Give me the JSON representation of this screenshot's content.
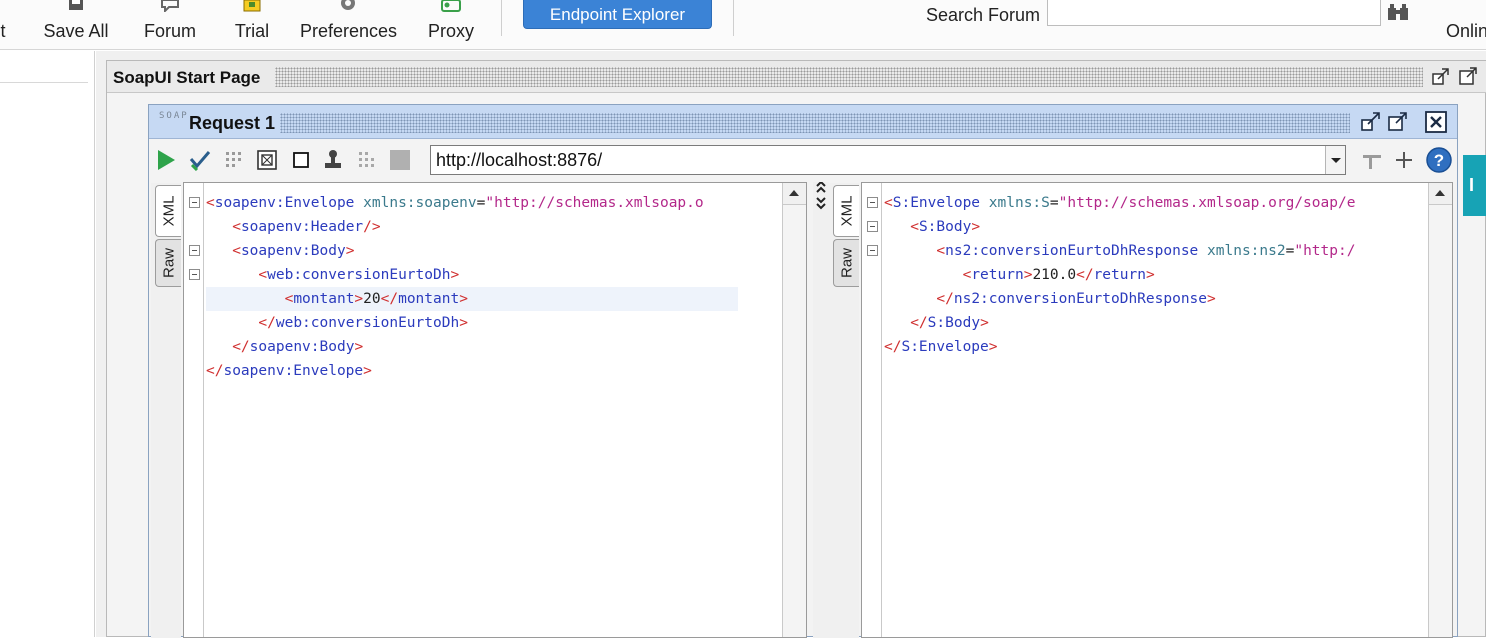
{
  "toolbar": {
    "cut_label": "t",
    "save_all": "Save All",
    "forum": "Forum",
    "trial": "Trial",
    "preferences": "Preferences",
    "proxy": "Proxy",
    "endpoint_explorer": "Endpoint Explorer",
    "search_label": "Search Forum",
    "search_value": "",
    "online": "Onlin"
  },
  "start_page": {
    "title": "SoapUI Start Page"
  },
  "request": {
    "soap_badge": "SOAP",
    "title": "Request 1",
    "url": "http://localhost:8876/",
    "tabs": {
      "xml": "XML",
      "raw": "Raw"
    }
  },
  "left_editor": {
    "lines": [
      {
        "indent": "",
        "o": "<",
        "tag": "soapenv:Envelope",
        "attr": " xmlns:soapenv",
        "eq": "=",
        "val": "\"http://schemas.xmlsoap.o",
        "c": ""
      },
      {
        "indent": "   ",
        "o": "<",
        "tag": "soapenv:Header",
        "c": "/>"
      },
      {
        "indent": "   ",
        "o": "<",
        "tag": "soapenv:Body",
        "c": ">"
      },
      {
        "indent": "      ",
        "o": "<",
        "tag": "web:conversionEurtoDh",
        "c": ">"
      },
      {
        "indent": "         ",
        "o": "<",
        "tag": "montant",
        "c": ">",
        "text": "20",
        "o2": "</",
        "tag2": "montant",
        "c2": ">"
      },
      {
        "indent": "      ",
        "o": "</",
        "tag": "web:conversionEurtoDh",
        "c": ">"
      },
      {
        "indent": "   ",
        "o": "</",
        "tag": "soapenv:Body",
        "c": ">"
      },
      {
        "indent": "",
        "o": "</",
        "tag": "soapenv:Envelope",
        "c": ">"
      }
    ]
  },
  "right_editor": {
    "lines": [
      {
        "indent": "",
        "o": "<",
        "tag": "S:Envelope",
        "attr": " xmlns:S",
        "eq": "=",
        "val": "\"http://schemas.xmlsoap.org/soap/e",
        "c": ""
      },
      {
        "indent": "   ",
        "o": "<",
        "tag": "S:Body",
        "c": ">"
      },
      {
        "indent": "      ",
        "o": "<",
        "tag": "ns2:conversionEurtoDhResponse",
        "attr": " xmlns:ns2",
        "eq": "=",
        "val": "\"http:/",
        "c": ""
      },
      {
        "indent": "         ",
        "o": "<",
        "tag": "return",
        "c": ">",
        "text": "210.0",
        "o2": "</",
        "tag2": "return",
        "c2": ">"
      },
      {
        "indent": "      ",
        "o": "</",
        "tag": "ns2:conversionEurtoDhResponse",
        "c": ">"
      },
      {
        "indent": "   ",
        "o": "</",
        "tag": "S:Body",
        "c": ">"
      },
      {
        "indent": "",
        "o": "</",
        "tag": "S:Envelope",
        "c": ">"
      }
    ]
  },
  "side_tab": {
    "label": "I"
  },
  "colors": {
    "accent": "#3b83d6",
    "title_blue": "#c6d9f3",
    "teal": "#17a3b5",
    "run_green": "#2ea34a"
  }
}
